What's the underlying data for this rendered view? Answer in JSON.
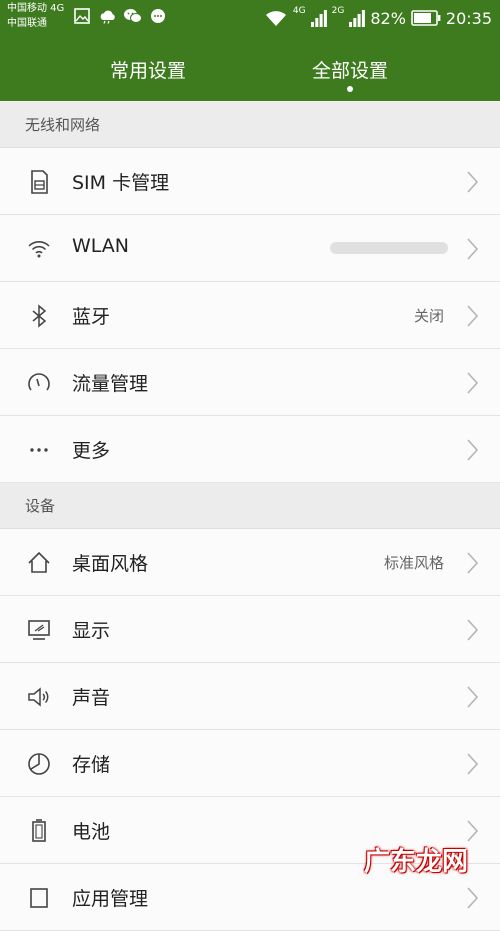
{
  "status_bar": {
    "carrier_1": "中国移动 4G",
    "carrier_2": "中国联通",
    "net_1": "4G",
    "net_2": "2G",
    "battery": "82%",
    "time": "20:35",
    "icons": [
      "gallery-icon",
      "cloud-icon",
      "wechat-icon",
      "messenger-icon",
      "wifi-icon",
      "signal-icon",
      "battery-icon"
    ]
  },
  "tabs": [
    {
      "label": "常用设置",
      "selected": false
    },
    {
      "label": "全部设置",
      "selected": true
    }
  ],
  "sections": {
    "wireless": "无线和网络",
    "device": "设备"
  },
  "rows": {
    "sim": {
      "label": "SIM 卡管理",
      "icon": "sim-card-icon"
    },
    "wlan": {
      "label": "WLAN",
      "icon": "wifi-icon"
    },
    "bluetooth": {
      "label": "蓝牙",
      "value": "关闭",
      "icon": "bluetooth-icon"
    },
    "data": {
      "label": "流量管理",
      "icon": "gauge-icon"
    },
    "more": {
      "label": "更多",
      "icon": "more-dots-icon"
    },
    "desktop": {
      "label": "桌面风格",
      "value": "标准风格",
      "icon": "home-icon"
    },
    "display": {
      "label": "显示",
      "icon": "display-icon"
    },
    "sound": {
      "label": "声音",
      "icon": "speaker-icon"
    },
    "storage": {
      "label": "存储",
      "icon": "storage-icon"
    },
    "battery": {
      "label": "电池",
      "icon": "battery-icon"
    },
    "apps": {
      "label": "应用管理",
      "icon": "apps-icon"
    }
  },
  "watermark": "广东龙网",
  "colors": {
    "header": "#3e7b1f",
    "section_bg": "#ececec",
    "row_bg": "#fbfbfb"
  }
}
